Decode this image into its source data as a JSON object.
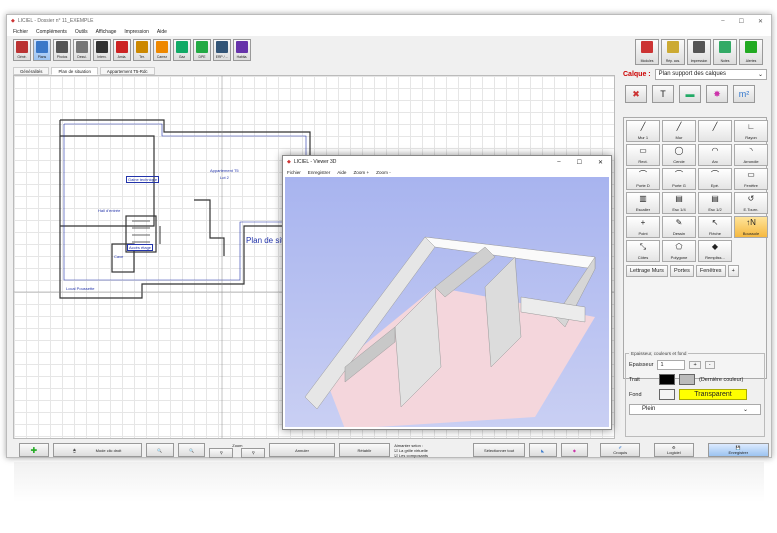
{
  "window": {
    "title": "LICIEL - Dossier n° 11_EXEMPLE",
    "controls": [
      "–",
      "☐",
      "✕"
    ]
  },
  "menu": [
    "Fichier",
    "Compléments",
    "Outils",
    "Affichage",
    "Impression",
    "Aide"
  ],
  "toolbar": [
    {
      "label": "Géné.",
      "color": "#b33"
    },
    {
      "label": "Plans",
      "color": "#3a78c8",
      "active": true
    },
    {
      "label": "Photos",
      "color": "#555"
    },
    {
      "label": "Dessi.",
      "color": "#777"
    },
    {
      "label": "Interv.",
      "color": "#333"
    },
    {
      "label": "Amia.",
      "color": "#c22"
    },
    {
      "label": "Ter.",
      "color": "#c80"
    },
    {
      "label": "Carrez",
      "color": "#e80"
    },
    {
      "label": "Gaz",
      "color": "#1a6"
    },
    {
      "label": "DPE",
      "color": "#2a4"
    },
    {
      "label": "ERP / ...",
      "color": "#357"
    },
    {
      "label": "Habita.",
      "color": "#63a"
    }
  ],
  "right_toolbar": [
    {
      "label": "Modules",
      "color": "#c33"
    },
    {
      "label": "Rép. acs.",
      "color": "#ca3"
    },
    {
      "label": "Impression",
      "color": "#555"
    },
    {
      "label": "Notes",
      "color": "#3a6"
    },
    {
      "label": "Alertes",
      "color": "#2a2"
    }
  ],
  "tabs": [
    {
      "label": "Généralités"
    },
    {
      "label": "Plan de situation",
      "selected": true
    },
    {
      "label": "Appartement T5-Rdc"
    }
  ],
  "plan": {
    "title": "Plan de situation",
    "rooms": [
      "Appartement T5",
      "Lot 2",
      "Hall d'entrée",
      "Gaine technique",
      "Accès étage",
      "Cave",
      "Local Poussette"
    ]
  },
  "viewer": {
    "title": "LICIEL - Viewer 3D",
    "menu": [
      "Fichier",
      "Enregistrer",
      "Aide",
      "Zoom +",
      "Zoom -"
    ]
  },
  "calque": {
    "label": "Calque :",
    "value": "Plan support des calques"
  },
  "tools": [
    {
      "g": "╱",
      "l": "Mur 1"
    },
    {
      "g": "╱",
      "l": "Mur"
    },
    {
      "g": "╱",
      "l": ""
    },
    {
      "g": "∟",
      "l": "Rayon"
    },
    {
      "g": "▭",
      "l": "Rect."
    },
    {
      "g": "◯",
      "l": "Cercle"
    },
    {
      "g": "◠",
      "l": "Arc"
    },
    {
      "g": "◝",
      "l": "Arrondie"
    },
    {
      "g": "⌒",
      "l": "Porte D"
    },
    {
      "g": "⌒",
      "l": "Porte G"
    },
    {
      "g": "⌒",
      "l": "Epé."
    },
    {
      "g": "▭",
      "l": "Fenêtre"
    },
    {
      "g": "▥",
      "l": "Escalier"
    },
    {
      "g": "▤",
      "l": "Esc 1/4"
    },
    {
      "g": "▤",
      "l": "Esc 1/2"
    },
    {
      "g": "↺",
      "l": "E.Tourn."
    },
    {
      "g": "+",
      "l": "Point"
    },
    {
      "g": "✎",
      "l": "Dessin"
    },
    {
      "g": "↖",
      "l": "Flèche"
    },
    {
      "g": "↑N",
      "l": "Boussole",
      "hl": true
    },
    {
      "g": "⤡",
      "l": "Côtes"
    },
    {
      "g": "⬠",
      "l": "Polygone"
    },
    {
      "g": "◆",
      "l": "Rempliss..."
    }
  ],
  "textbuttons": [
    "Lettrage Murs",
    "Portes",
    "Fenêtres",
    "+"
  ],
  "props": {
    "title": "Epaisseur, couleurs et fond",
    "epaisseur_label": "Epaisseur",
    "epaisseur": "1",
    "trait_label": "Trait",
    "last_color": "(Dernière couleur)",
    "fond_label": "Fond",
    "fond_value": "Transparent",
    "fill": "Plein"
  },
  "bottom": {
    "mode": "Mode clic droit",
    "zoom": "Zoom",
    "annuler": "Annuler",
    "retablir": "Rétablir",
    "aimanter": "Aimanter selon :",
    "grille": "La grille virtuelle",
    "composants": "Les composants",
    "selection": "Sélectionner tout",
    "croquis": "Croquis",
    "logiciel": "Logiciel",
    "enregistrer": "Enregistrer"
  }
}
